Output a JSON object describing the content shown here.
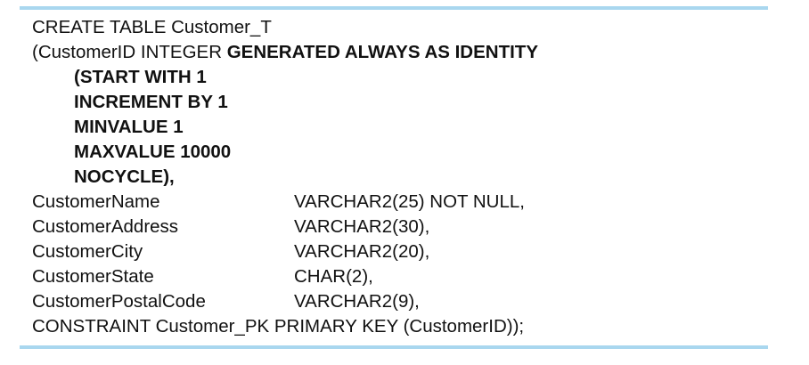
{
  "sql": {
    "line1": "CREATE TABLE Customer_T",
    "line2_plain": "(CustomerID INTEGER ",
    "line2_bold": "GENERATED ALWAYS AS IDENTITY",
    "identity_options": [
      "(START WITH 1",
      "INCREMENT BY 1",
      "MINVALUE 1",
      "MAXVALUE 10000",
      "NOCYCLE),"
    ],
    "columns": [
      {
        "name": "CustomerName",
        "type": "VARCHAR2(25) NOT NULL,"
      },
      {
        "name": "CustomerAddress",
        "type": "VARCHAR2(30),"
      },
      {
        "name": "CustomerCity",
        "type": "VARCHAR2(20),"
      },
      {
        "name": "CustomerState",
        "type": "CHAR(2),"
      },
      {
        "name": "CustomerPostalCode",
        "type": "VARCHAR2(9),"
      }
    ],
    "constraint": "CONSTRAINT Customer_PK PRIMARY KEY (CustomerID));"
  },
  "colors": {
    "rule": "#a9d7ef",
    "text": "#111111"
  }
}
